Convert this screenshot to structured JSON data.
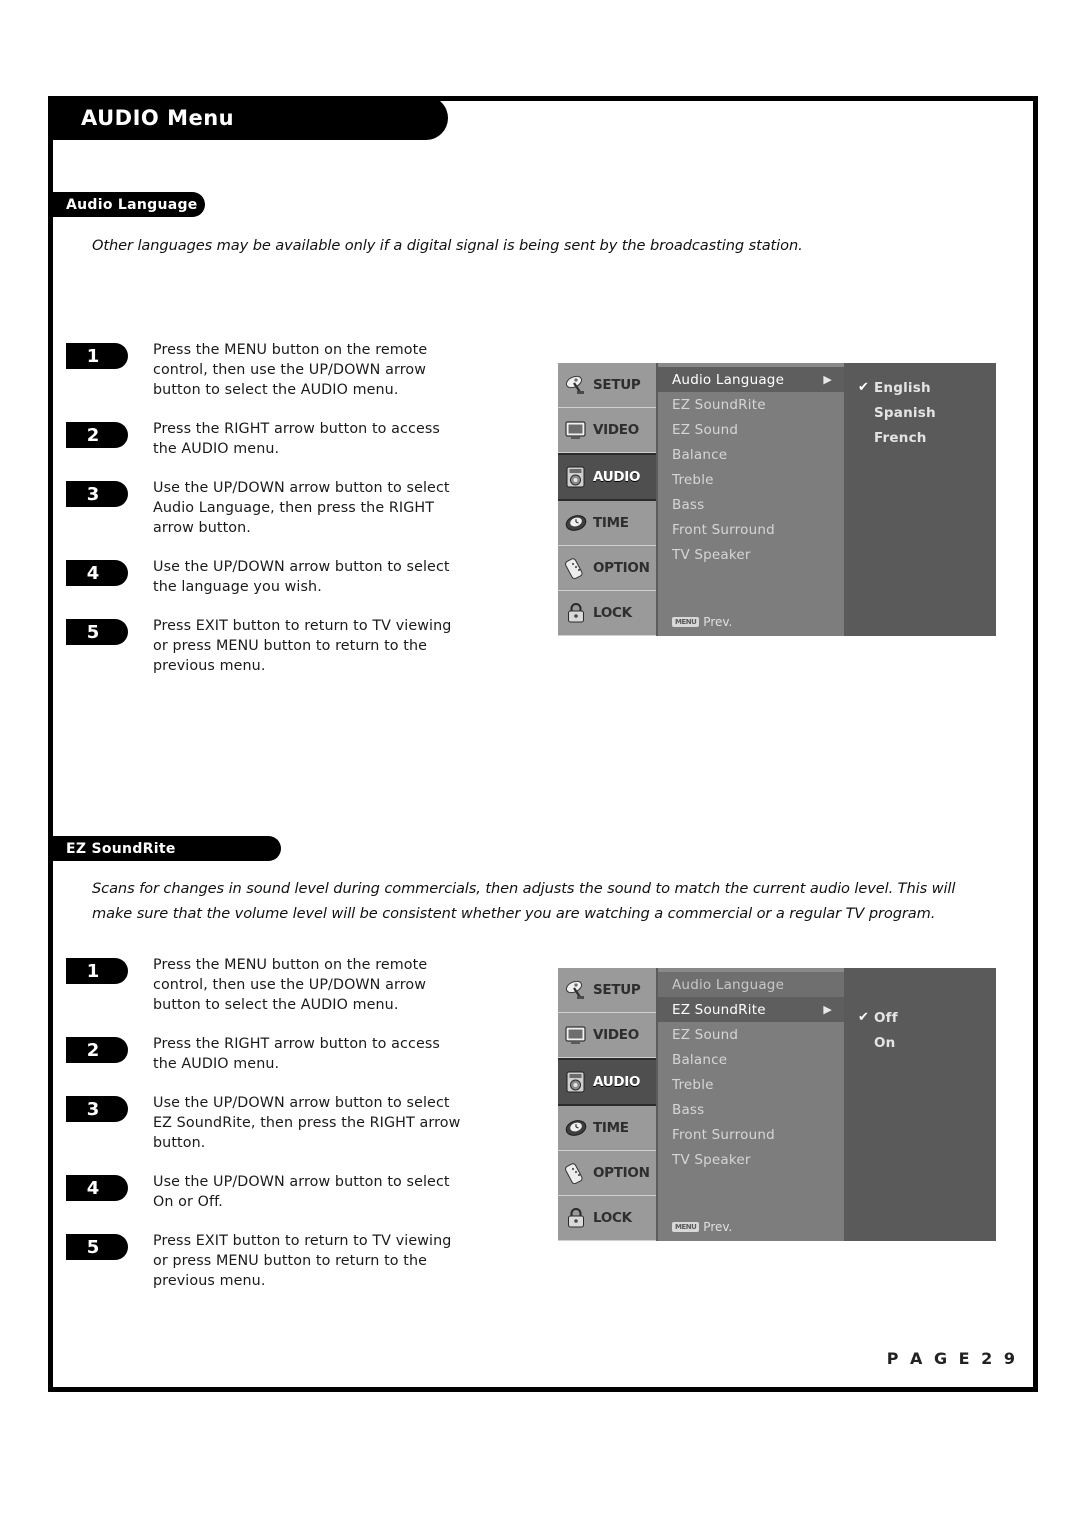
{
  "document": {
    "page_label": "P A G E   2 9",
    "title": "AUDIO Menu"
  },
  "sections": [
    {
      "id": "audio-language",
      "heading": "Audio Language",
      "description": "Other languages may be available only if a digital signal is being sent by the broadcasting station.",
      "steps": [
        {
          "number": "1",
          "text": "Press the MENU button on the remote\ncontrol, then use the UP/DOWN arrow\nbutton to select the AUDIO menu."
        },
        {
          "number": "2",
          "text": "Press the RIGHT arrow button to access\nthe AUDIO menu."
        },
        {
          "number": "3",
          "text": "Use the UP/DOWN arrow button to select\nAudio Language, then press the RIGHT\narrow button."
        },
        {
          "number": "4",
          "text": "Use the UP/DOWN arrow button to select\nthe language you wish."
        },
        {
          "number": "5",
          "text": "Press EXIT button to return to TV viewing\nor press MENU button to return to the\nprevious menu."
        }
      ]
    },
    {
      "id": "ez-soundrite",
      "heading": "EZ SoundRite",
      "description": "Scans for changes in sound level during commercials, then adjusts the sound to match the current audio level. This will make sure that the volume level will be consistent whether you are watching a commercial or a regular TV program.",
      "steps": [
        {
          "number": "1",
          "text": "Press the MENU button on the remote\ncontrol, then use the UP/DOWN arrow\nbutton to select the AUDIO menu."
        },
        {
          "number": "2",
          "text": "Press the RIGHT arrow button to access\nthe AUDIO menu."
        },
        {
          "number": "3",
          "text": "Use the UP/DOWN arrow button to select\nEZ SoundRite, then press the RIGHT arrow\nbutton."
        },
        {
          "number": "4",
          "text": "Use the UP/DOWN arrow button to select\nOn or Off."
        },
        {
          "number": "5",
          "text": "Press EXIT button to return to TV viewing\nor press MENU button to return to the\nprevious menu."
        }
      ]
    }
  ],
  "osd": {
    "sidebar": [
      {
        "label": "SETUP",
        "icon": "satellite-dish-icon",
        "active": false
      },
      {
        "label": "VIDEO",
        "icon": "monitor-icon",
        "active": false
      },
      {
        "label": "AUDIO",
        "icon": "speaker-icon",
        "active": true
      },
      {
        "label": "TIME",
        "icon": "clock-icon",
        "active": false
      },
      {
        "label": "OPTION",
        "icon": "remote-icon",
        "active": false
      },
      {
        "label": "LOCK",
        "icon": "padlock-icon",
        "active": false
      }
    ],
    "menu_items": [
      "Audio Language",
      "EZ SoundRite",
      "EZ Sound",
      "Balance",
      "Treble",
      "Bass",
      "Front Surround",
      "TV Speaker"
    ],
    "prev_key": "MENU",
    "prev_label": "Prev.",
    "screen_one": {
      "selected_item": "Audio Language",
      "selected_index": 0,
      "arrow_glyph": "▶",
      "options": [
        {
          "label": "English",
          "checked": true
        },
        {
          "label": "Spanish",
          "checked": false
        },
        {
          "label": "French",
          "checked": false
        }
      ],
      "check_glyph": "✔"
    },
    "screen_two": {
      "selected_item": "EZ SoundRite",
      "selected_index": 1,
      "arrow_glyph": "▶",
      "options": [
        {
          "label": "Off",
          "checked": true
        },
        {
          "label": "On",
          "checked": false
        }
      ],
      "check_glyph": "✔"
    }
  },
  "colors": {
    "frame": "#000000",
    "pill": "#000000",
    "osd_background": "#8d8d8d",
    "osd_highlight": "#5e5e5e",
    "osd_option_panel": "#5a5a5a"
  }
}
